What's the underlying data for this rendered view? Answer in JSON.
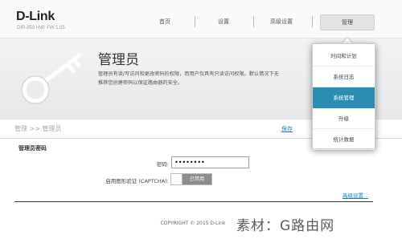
{
  "header": {
    "logo": "D-Link",
    "model": "DIR-859   HW:    FW:1.05",
    "nav": {
      "home": "首页",
      "settings": "设置",
      "advanced": "高级设置",
      "management": "管理"
    }
  },
  "banner": {
    "title": "管理员",
    "desc_line1": "管理员有读/写访问和更改密码的权限，而用户仅具有只读访问权限。默认情况下无",
    "desc_line2": "推荐您创建密码以保证路由器的安全。"
  },
  "breadcrumb": "管理 >> 管理员",
  "save_label": "保存",
  "section_title": "管理员密码",
  "form": {
    "password_label": "密码:",
    "password_value": "••••••••",
    "captcha_label": "启用图形验证 (CAPTCHA):",
    "captcha_state": "已禁用"
  },
  "advanced_link": "高级设置...",
  "copyright": "COPYRIGHT © 2015 D-Link",
  "watermark": "素材：G路由网",
  "dropdown": {
    "items": [
      "时间和计划",
      "系统日志",
      "系统管理",
      "升级",
      "统计数据"
    ],
    "active_index": 2
  },
  "colors": {
    "accent": "#2b8db2",
    "link": "#1c7ea8",
    "toggle_off": "#8c8c8c"
  }
}
